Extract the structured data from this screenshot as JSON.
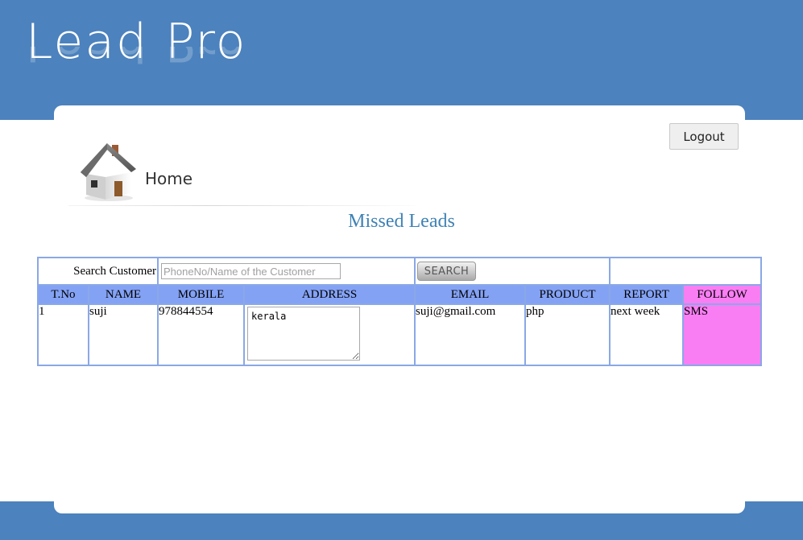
{
  "header": {
    "logo_text": "Lead Pro",
    "brand_color": "#4c82bd"
  },
  "toolbar": {
    "logout_label": "Logout"
  },
  "nav": {
    "home_label": "Home",
    "home_icon": "house-icon"
  },
  "page": {
    "title": "Missed Leads",
    "title_color": "#3f82b4"
  },
  "search": {
    "label": "Search Customer",
    "placeholder": "PhoneNo/Name of the Customer",
    "button_label": "SEARCH"
  },
  "table": {
    "header_color": "#84a2f4",
    "follow_color": "#f97ef4",
    "columns": [
      "T.No",
      "NAME",
      "MOBILE",
      "ADDRESS",
      "EMAIL",
      "PRODUCT",
      "REPORT",
      "FOLLOW"
    ],
    "rows": [
      {
        "tno": "1",
        "name": "suji",
        "mobile": "978844554",
        "address": "kerala",
        "email": "suji@gmail.com",
        "product": "php",
        "report": "next week",
        "follow": "SMS"
      }
    ]
  }
}
